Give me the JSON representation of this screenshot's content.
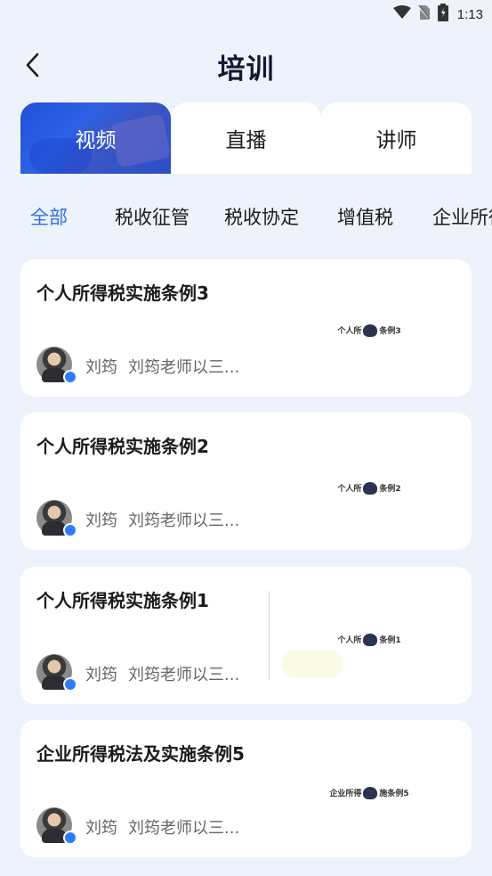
{
  "status": {
    "time": "1:13",
    "icons": [
      "wifi-icon",
      "no-sim-icon",
      "battery-icon"
    ]
  },
  "header": {
    "title": "培训",
    "back_icon": "chevron-left-icon"
  },
  "tabs": [
    {
      "label": "视频",
      "active": true
    },
    {
      "label": "直播",
      "active": false
    },
    {
      "label": "讲师",
      "active": false
    }
  ],
  "categories": [
    {
      "label": "全部",
      "active": true
    },
    {
      "label": "税收征管",
      "active": false
    },
    {
      "label": "税收协定",
      "active": false
    },
    {
      "label": "增值税",
      "active": false
    },
    {
      "label": "企业所得税",
      "active": false
    }
  ],
  "courses": [
    {
      "title": "个人所得税实施条例3",
      "teacher": "刘筠",
      "desc": "刘筠老师以三...",
      "thumb_left": "个人所",
      "thumb_right": "条例3"
    },
    {
      "title": "个人所得税实施条例2",
      "teacher": "刘筠",
      "desc": "刘筠老师以三...",
      "thumb_left": "个人所",
      "thumb_right": "条例2"
    },
    {
      "title": "个人所得税实施条例1",
      "teacher": "刘筠",
      "desc": "刘筠老师以三...",
      "thumb_left": "个人所",
      "thumb_right": "条例1"
    },
    {
      "title": "企业所得税法及实施条例5",
      "teacher": "刘筠",
      "desc": "刘筠老师以三...",
      "thumb_left": "企业所得",
      "thumb_right": "施条例5"
    }
  ],
  "colors": {
    "accent": "#2f6ee8",
    "background": "#eef2fb",
    "tab_active": "#2a5ad8"
  }
}
